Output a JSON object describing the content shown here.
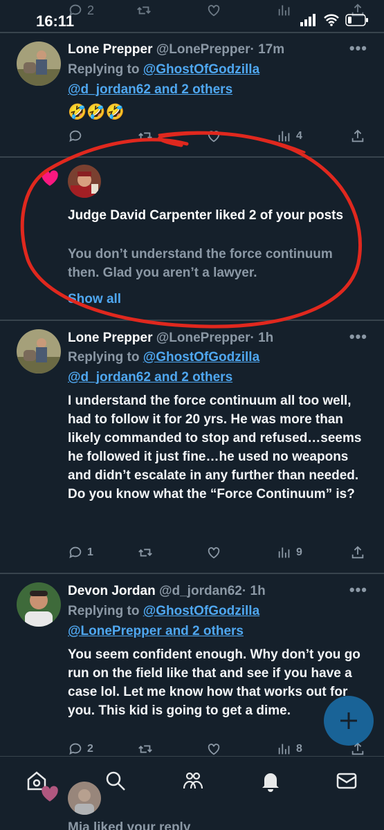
{
  "status_bar": {
    "time": "16:11"
  },
  "previous_tweet_actions": {
    "reply_count": "2"
  },
  "tweets": [
    {
      "name": "Lone Prepper",
      "handle": "@LonePrepper",
      "time": "· 17m",
      "replying_prefix": "Replying to",
      "replying_to_1": "@GhostOfGodzilla",
      "replying_to_2": "@d_jordan62 and 2 others",
      "text": "🤣🤣🤣",
      "reply_count": "",
      "retweet_count": "",
      "like_count": "",
      "view_count": "4"
    },
    {
      "name": "Lone Prepper",
      "handle": "@LonePrepper",
      "time": "· 1h",
      "replying_prefix": "Replying to",
      "replying_to_1": "@GhostOfGodzilla",
      "replying_to_2": "@d_jordan62 and 2 others",
      "text": "I understand the force continuum all too well, had to follow it for 20 yrs.  He was more than likely commanded to stop and refused…seems he followed it just fine…he used no weapons and didn’t escalate in any further than needed.\nDo you know what the “Force Continuum” is?",
      "reply_count": "1",
      "retweet_count": "",
      "like_count": "",
      "view_count": "9"
    },
    {
      "name": "Devon Jordan",
      "handle": "@d_jordan62",
      "time": "· 1h",
      "replying_prefix": "Replying to",
      "replying_to_1": "@GhostOfGodzilla",
      "replying_to_2": "@LonePrepper and 2 others",
      "text": "You seem confident enough. Why don’t you go run on the field like that and see if you have a case lol. Let me know how that works out for you. This kid is going to get a dime.",
      "reply_count": "2",
      "retweet_count": "",
      "like_count": "",
      "view_count": "8"
    }
  ],
  "like_notification": {
    "title": "Judge David Carpenter liked 2 of your posts",
    "snippet": "You don’t understand the force continuum then. Glad you aren’t a lawyer.",
    "show_all": "Show all"
  },
  "bottom_notification": {
    "text": "Mia liked your reply"
  },
  "colors": {
    "background": "#15202b",
    "divider": "#38444d",
    "link": "#4fa7f0",
    "secondary_text": "#8b98a5",
    "heart": "#f91880",
    "annotation_red": "#e0281e"
  },
  "icons": [
    "home-icon",
    "search-icon",
    "communities-icon",
    "notifications-icon",
    "messages-icon",
    "compose-plus-icon",
    "heart-icon",
    "reply-icon",
    "retweet-icon",
    "like-icon",
    "views-icon",
    "share-icon",
    "more-icon"
  ]
}
